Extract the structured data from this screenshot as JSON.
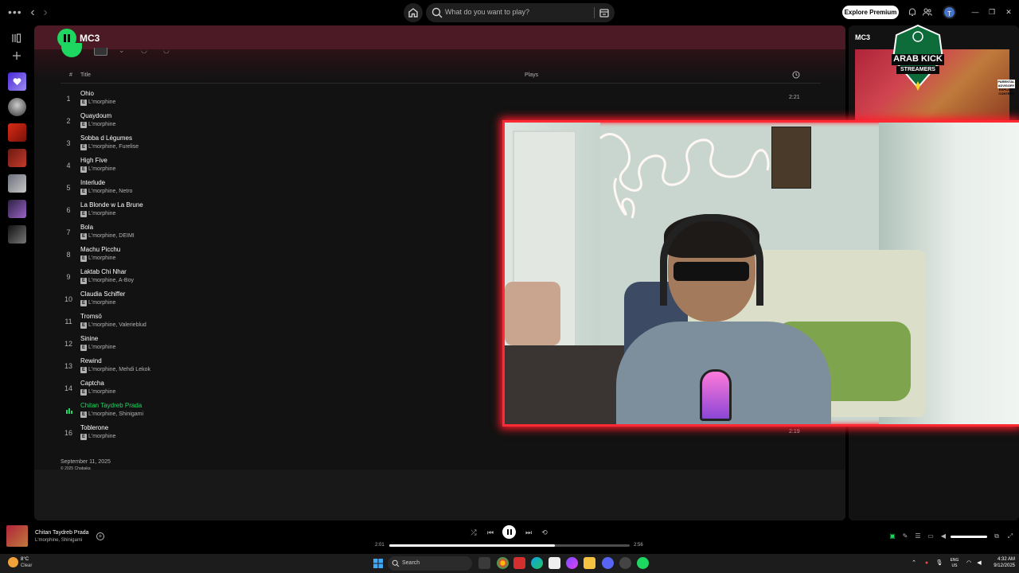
{
  "topbar": {
    "search_placeholder": "What do you want to play?",
    "premium_label": "Explore Premium",
    "avatar_initial": "T"
  },
  "playlist": {
    "title": "MC3",
    "columns": {
      "index": "#",
      "title": "Title",
      "plays": "Plays"
    },
    "tracks": [
      {
        "num": "1",
        "title": "Ohio",
        "artist": "L'morphine",
        "duration": "2:21"
      },
      {
        "num": "2",
        "title": "Quaydoum",
        "artist": "L'morphine",
        "duration": ""
      },
      {
        "num": "3",
        "title": "Sobba d Légumes",
        "artist": "L'morphine, Furelise",
        "duration": ""
      },
      {
        "num": "4",
        "title": "High Five",
        "artist": "L'morphine",
        "duration": ""
      },
      {
        "num": "5",
        "title": "Interlude",
        "artist": "L'morphine, Netro",
        "duration": ""
      },
      {
        "num": "6",
        "title": "La Blonde w La Brune",
        "artist": "L'morphine",
        "duration": ""
      },
      {
        "num": "7",
        "title": "Bola",
        "artist": "L'morphine, DEIMI",
        "duration": ""
      },
      {
        "num": "8",
        "title": "Machu Picchu",
        "artist": "L'morphine",
        "duration": ""
      },
      {
        "num": "9",
        "title": "Laktab Chi Nhar",
        "artist": "L'morphine, A-Boy",
        "duration": ""
      },
      {
        "num": "10",
        "title": "Claudia Schiffer",
        "artist": "L'morphine",
        "duration": ""
      },
      {
        "num": "11",
        "title": "Tromsö",
        "artist": "L'morphine, Valerieblud",
        "duration": ""
      },
      {
        "num": "12",
        "title": "Sinine",
        "artist": "L'morphine",
        "duration": ""
      },
      {
        "num": "13",
        "title": "Rewind",
        "artist": "L'morphine, Mehdi Lekok",
        "duration": ""
      },
      {
        "num": "14",
        "title": "Captcha",
        "artist": "L'morphine",
        "duration": ""
      },
      {
        "num": "",
        "title": "Chitan Taydreb Prada",
        "artist": "L'morphine, Shinigami",
        "duration": "",
        "playing": true
      },
      {
        "num": "16",
        "title": "Toblerone",
        "artist": "L'morphine",
        "duration": "2:19"
      }
    ],
    "explicit_badge": "E",
    "release_date": "September 11, 2025",
    "copyright": "© 2025 Chabaka"
  },
  "right_panel": {
    "title": "MC3",
    "advisory_label": "PARENTAL ADVISORY EXPLICIT CONTENT"
  },
  "overlay_logo": {
    "line1": "ARAB KICK",
    "line2": "STREAMERS"
  },
  "now_playing": {
    "title": "Chitan Taydreb Prada",
    "artist": "L'morphine, Shinigami",
    "elapsed": "2:01",
    "total": "2:56",
    "progress_fraction": 0.69,
    "volume_fraction": 1.0
  },
  "taskbar": {
    "weather_temp": "8°C",
    "weather_cond": "Clear",
    "search_label": "Search",
    "lang_top": "ENG",
    "lang_bottom": "US",
    "time": "4:32 AM",
    "date": "9/12/2025"
  },
  "colors": {
    "accent": "#1ed760",
    "header": "#4b1a24",
    "cam_border": "#ff2a34"
  }
}
